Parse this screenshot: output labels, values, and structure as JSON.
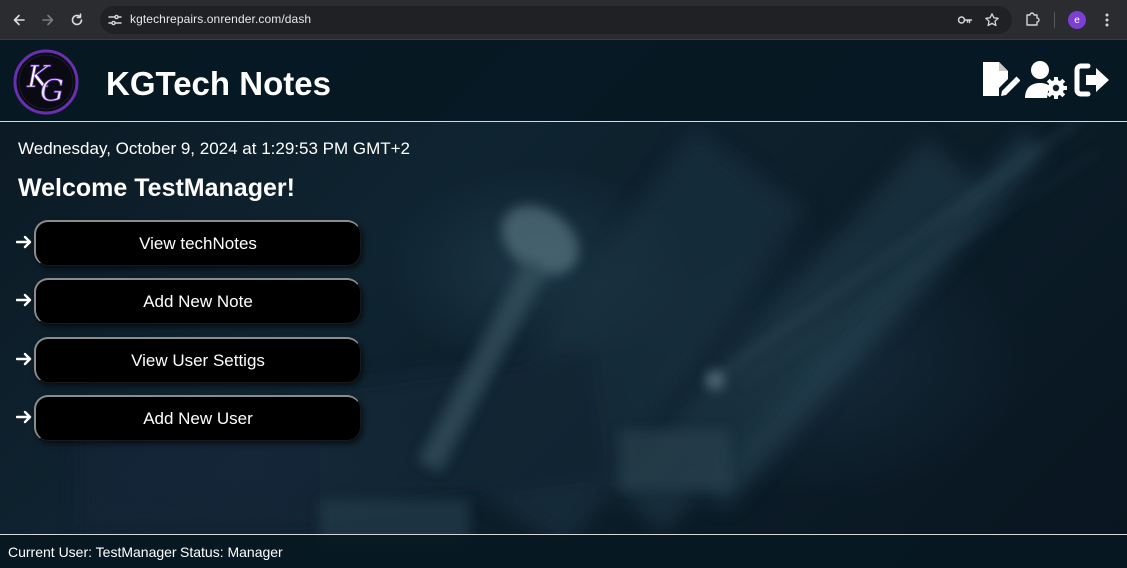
{
  "browser": {
    "url": "kgtechrepairs.onrender.com/dash",
    "profile_initial": "e"
  },
  "header": {
    "title": "KGTech Notes",
    "logo_text": "KG",
    "actions": [
      {
        "name": "new-note",
        "icon": "file-pen-icon"
      },
      {
        "name": "user-settings",
        "icon": "user-gear-icon"
      },
      {
        "name": "logout",
        "icon": "logout-icon"
      }
    ]
  },
  "main": {
    "datetime": "Wednesday, October 9, 2024 at 1:29:53 PM GMT+2",
    "welcome": "Welcome TestManager!",
    "links": [
      {
        "label": "View techNotes",
        "icon": "arrow-right-icon"
      },
      {
        "label": "Add New Note",
        "icon": "arrow-right-icon"
      },
      {
        "label": "View User Settigs",
        "icon": "arrow-right-icon"
      },
      {
        "label": "Add New User",
        "icon": "arrow-right-icon"
      }
    ]
  },
  "footer": {
    "current_user": "Current User: TestManager",
    "status": "Status: Manager"
  },
  "colors": {
    "header_bg": "#061822",
    "link_bg": "#000000",
    "text": "#ffffff",
    "logo_purple": "#6a2fb0"
  }
}
